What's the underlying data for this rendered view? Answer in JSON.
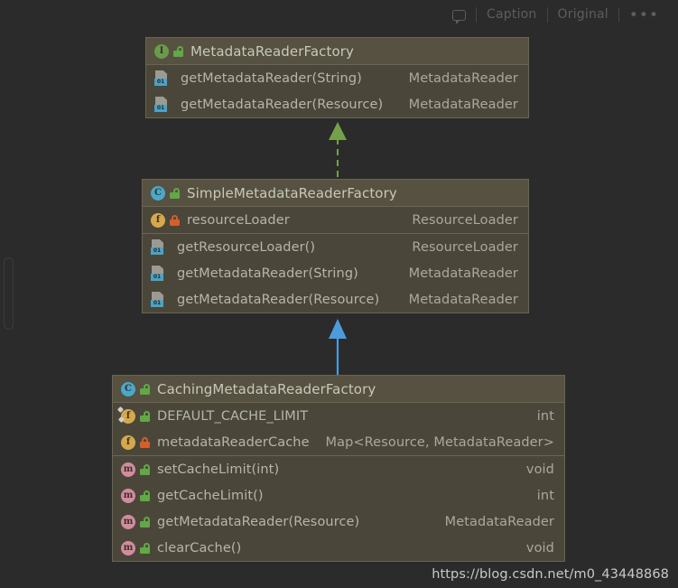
{
  "toolbar": {
    "comment_icon": "speech-bubble-icon",
    "caption_label": "Caption",
    "original_label": "Original",
    "more_label": "•••"
  },
  "colors": {
    "canvas_bg": "#2b2b2b",
    "box_bg": "#4a473a",
    "box_header_bg": "#565141",
    "box_border": "#6b6550",
    "interface_icon": "#6a9b4b",
    "class_icon": "#4ba8c9",
    "field_icon": "#d7a84b",
    "method_icon": "#d28b9f",
    "lock_public": "#62a844",
    "lock_private": "#d3602a",
    "implements_arrow": "#72a14a",
    "extends_arrow": "#4b9cdd",
    "text": "#b6b6a8"
  },
  "diagram": {
    "classes": [
      {
        "id": "metadata-reader-factory",
        "kind_icon": "interface-icon",
        "visibility_icon": "lock-open-icon",
        "name": "MetadataReaderFactory",
        "sections": [
          {
            "rows": [
              {
                "icon": "abstract-method-icon",
                "name": "getMetadataReader(String)",
                "type": "MetadataReader"
              },
              {
                "icon": "abstract-method-icon",
                "name": "getMetadataReader(Resource)",
                "type": "MetadataReader"
              }
            ]
          }
        ]
      },
      {
        "id": "simple-metadata-reader-factory",
        "kind_icon": "class-icon",
        "visibility_icon": "lock-open-icon",
        "name": "SimpleMetadataReaderFactory",
        "sections": [
          {
            "rows": [
              {
                "icon": "field-icon",
                "visibility_icon": "lock-closed-icon",
                "name": "resourceLoader",
                "type": "ResourceLoader"
              }
            ]
          },
          {
            "rows": [
              {
                "icon": "abstract-method-icon",
                "name": "getResourceLoader()",
                "type": "ResourceLoader"
              },
              {
                "icon": "abstract-method-icon",
                "name": "getMetadataReader(String)",
                "type": "MetadataReader"
              },
              {
                "icon": "abstract-method-icon",
                "name": "getMetadataReader(Resource)",
                "type": "MetadataReader"
              }
            ]
          }
        ]
      },
      {
        "id": "caching-metadata-reader-factory",
        "kind_icon": "class-icon",
        "visibility_icon": "lock-open-icon",
        "name": "CachingMetadataReaderFactory",
        "sections": [
          {
            "rows": [
              {
                "icon": "static-field-icon",
                "visibility_icon": "lock-open-icon",
                "name": "DEFAULT_CACHE_LIMIT",
                "type": "int"
              },
              {
                "icon": "field-icon",
                "visibility_icon": "lock-closed-icon",
                "name": "metadataReaderCache",
                "type": "Map<Resource, MetadataReader>"
              }
            ]
          },
          {
            "rows": [
              {
                "icon": "method-icon",
                "visibility_icon": "lock-open-icon",
                "name": "setCacheLimit(int)",
                "type": "void"
              },
              {
                "icon": "method-icon",
                "visibility_icon": "lock-open-icon",
                "name": "getCacheLimit()",
                "type": "int"
              },
              {
                "icon": "method-icon",
                "visibility_icon": "lock-open-icon",
                "name": "getMetadataReader(Resource)",
                "type": "MetadataReader"
              },
              {
                "icon": "method-icon",
                "visibility_icon": "lock-open-icon",
                "name": "clearCache()",
                "type": "void"
              }
            ]
          }
        ]
      }
    ],
    "connectors": [
      {
        "id": "implements-arrow",
        "relation": "implements",
        "from": "simple-metadata-reader-factory",
        "to": "metadata-reader-factory",
        "style": "dashed",
        "color": "#72a14a"
      },
      {
        "id": "extends-arrow",
        "relation": "extends",
        "from": "caching-metadata-reader-factory",
        "to": "simple-metadata-reader-factory",
        "style": "solid",
        "color": "#4b9cdd"
      }
    ]
  },
  "watermark": {
    "text": "https://blog.csdn.net/m0_43448868"
  }
}
